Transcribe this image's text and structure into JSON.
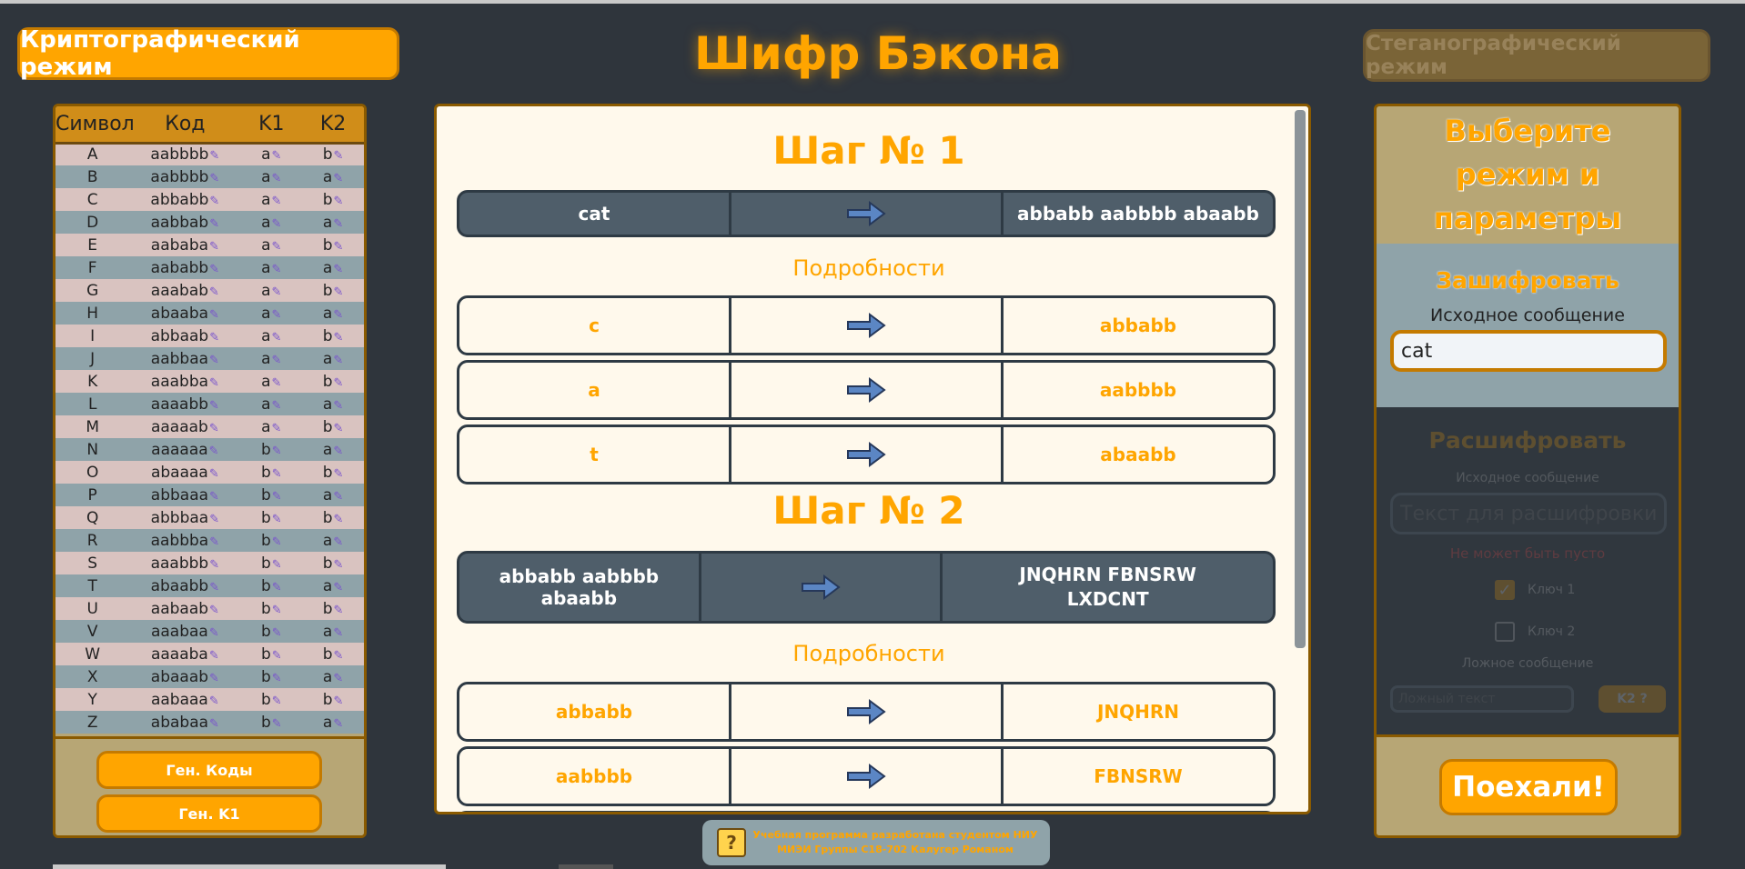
{
  "header": {
    "title": "Шифр Бэкона",
    "crypto_mode_label": "Криптографический режим",
    "stego_mode_label": "Стеганографический режим"
  },
  "code_table": {
    "headers": [
      "Символ",
      "Код",
      "K1",
      "K2"
    ],
    "rows": [
      [
        "A",
        "aabbbb",
        "a",
        "b"
      ],
      [
        "B",
        "aabbbb",
        "a",
        "a"
      ],
      [
        "C",
        "abbabb",
        "a",
        "b"
      ],
      [
        "D",
        "aabbab",
        "a",
        "a"
      ],
      [
        "E",
        "aababa",
        "a",
        "b"
      ],
      [
        "F",
        "aababb",
        "a",
        "a"
      ],
      [
        "G",
        "aaabab",
        "a",
        "b"
      ],
      [
        "H",
        "abaaba",
        "a",
        "a"
      ],
      [
        "I",
        "abbaab",
        "a",
        "b"
      ],
      [
        "J",
        "aabbaa",
        "a",
        "a"
      ],
      [
        "K",
        "aaabba",
        "a",
        "b"
      ],
      [
        "L",
        "aaaabb",
        "a",
        "a"
      ],
      [
        "M",
        "aaaaab",
        "a",
        "b"
      ],
      [
        "N",
        "aaaaaa",
        "b",
        "a"
      ],
      [
        "O",
        "abaaaa",
        "b",
        "b"
      ],
      [
        "P",
        "abbaaa",
        "b",
        "a"
      ],
      [
        "Q",
        "abbbaa",
        "b",
        "b"
      ],
      [
        "R",
        "aabbba",
        "b",
        "a"
      ],
      [
        "S",
        "aaabbb",
        "b",
        "b"
      ],
      [
        "T",
        "abaabb",
        "b",
        "a"
      ],
      [
        "U",
        "aabaab",
        "b",
        "b"
      ],
      [
        "V",
        "aaabaa",
        "b",
        "a"
      ],
      [
        "W",
        "aaaaba",
        "b",
        "b"
      ],
      [
        "X",
        "abaaab",
        "b",
        "a"
      ],
      [
        "Y",
        "aabaaa",
        "b",
        "b"
      ],
      [
        "Z",
        "ababaa",
        "b",
        "a"
      ]
    ],
    "gen_codes_label": "Ген. Коды",
    "gen_k1_label": "Ген. K1"
  },
  "steps": [
    {
      "title": "Шаг № 1",
      "summary": {
        "input": "cat",
        "output": "abbabb aabbbb abaabb"
      },
      "details_title": "Подробности",
      "details": [
        {
          "input": "c",
          "output": "abbabb"
        },
        {
          "input": "a",
          "output": "aabbbb"
        },
        {
          "input": "t",
          "output": "abaabb"
        }
      ]
    },
    {
      "title": "Шаг № 2",
      "summary": {
        "input": "abbabb aabbbb abaabb",
        "output": "JNQHRN FBNSRW LXDCNT"
      },
      "details_title": "Подробности",
      "details": [
        {
          "input": "abbabb",
          "output": "JNQHRN"
        },
        {
          "input": "aabbbb",
          "output": "FBNSRW"
        }
      ]
    }
  ],
  "right_panel": {
    "title": "Выберите режим и параметры",
    "encrypt": {
      "title": "Зашифровать",
      "label": "Исходное сообщение",
      "value": "cat"
    },
    "decrypt": {
      "title": "Расшифровать",
      "label": "Исходное сообщение",
      "placeholder": "Текст для расшифровки",
      "error": "Не может быть пусто",
      "key1_label": "Ключ 1",
      "key2_label": "Ключ 2",
      "false_label": "Ложное сообщение",
      "false_placeholder": "Ложный текст",
      "false_btn": "K2 ?"
    },
    "go_label": "Поехали!"
  },
  "footer": {
    "help_icon": "?",
    "line1": "Учебная программа разработана студентом НИУ",
    "line2": "МИЭИ Группы С18-702 Калугер Романом"
  },
  "colors": {
    "accent": "#ffa500",
    "background": "#2f353c",
    "panel": "#b7a675",
    "row_pink": "#d9c3c0",
    "row_blue": "#8fa3a9",
    "dark_row": "#4f5e6a"
  },
  "icons": {
    "edit": "pencil-icon",
    "flow": "arrow-right-icon",
    "help": "question-icon",
    "checkbox": "checkmark-icon"
  }
}
